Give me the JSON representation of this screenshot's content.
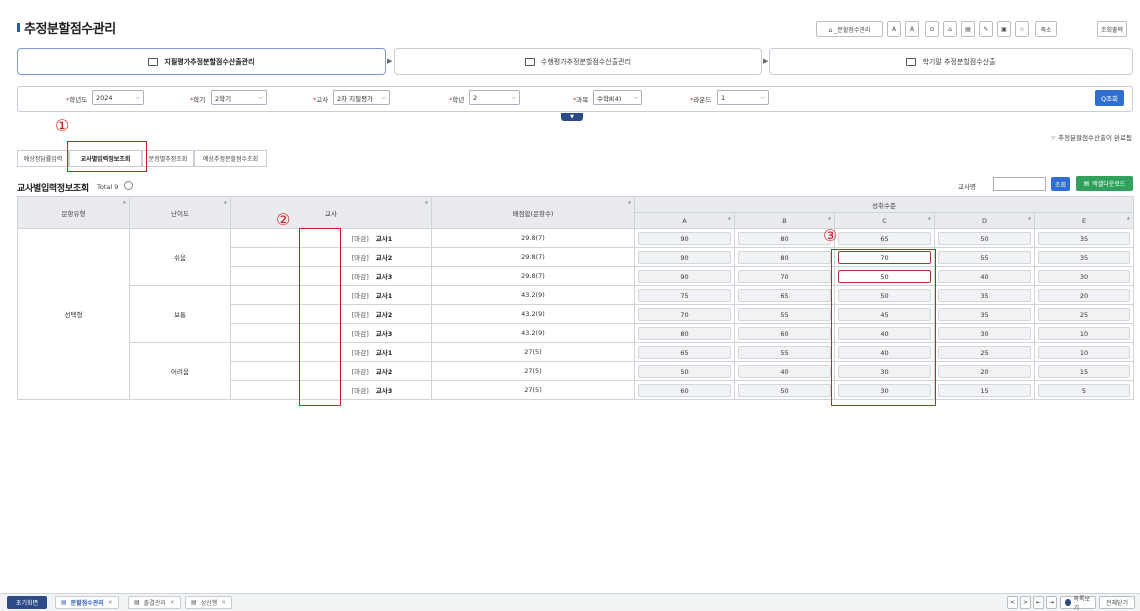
{
  "page_title": "추정분할점수관리",
  "toolbar": {
    "favorite_label": "⌂ _분할점수관리",
    "buttons": [
      "A",
      "A",
      "⊙",
      "⌂",
      "▤",
      "✎",
      "▣",
      "☆"
    ],
    "shrink_label": "축소",
    "screen_label": "조회출력"
  },
  "steps": [
    {
      "label": "지필평가추정분할점수산출관리"
    },
    {
      "label": "수행평가추정분할점수산출관리"
    },
    {
      "label": "학기말 추정분할점수산출"
    }
  ],
  "filters": {
    "year_label": "학년도",
    "year_value": "2024",
    "term_label": "학기",
    "term_value": "2학기",
    "exam_label": "고사",
    "exam_value": "2차 지필평가",
    "grade_label": "학년",
    "grade_value": "2",
    "subject_label": "과목",
    "subject_value": "수학Ⅱ(4)",
    "round_label": "라운드",
    "round_value": "1",
    "search_label": "Q조회"
  },
  "note_right": "☞ 추정분할점수산출이 완료됨",
  "annotations": {
    "one": "①",
    "two": "②",
    "three": "③"
  },
  "subtabs": [
    "예상정답률입력",
    "교사별입력정보조회",
    "문항별추정조회",
    "예상추정분할점수조회"
  ],
  "section": {
    "title": "교사별입력정보조회",
    "total": "Total 9",
    "teacher_name_label": "교사명",
    "search_label": "조회",
    "excel_label": "엑셀다운로드"
  },
  "table": {
    "headers": {
      "type": "문항유형",
      "difficulty": "난이도",
      "teacher": "교사",
      "points": "배점합(문항수)",
      "level": "성취수준",
      "levels": [
        "A",
        "B",
        "C",
        "D",
        "E"
      ]
    },
    "group_type": "선택형",
    "groups": [
      {
        "difficulty": "쉬움",
        "rows": [
          {
            "mark": "[마감]",
            "teacher": "교사1",
            "points": "29.8(7)",
            "scores": [
              "90",
              "80",
              "65",
              "50",
              "35"
            ]
          },
          {
            "mark": "[마감]",
            "teacher": "교사2",
            "points": "29.8(7)",
            "scores": [
              "90",
              "80",
              "70",
              "55",
              "35"
            ]
          },
          {
            "mark": "[마감]",
            "teacher": "교사3",
            "points": "29.8(7)",
            "scores": [
              "90",
              "70",
              "50",
              "40",
              "30"
            ]
          }
        ]
      },
      {
        "difficulty": "보통",
        "rows": [
          {
            "mark": "[마감]",
            "teacher": "교사1",
            "points": "43.2(9)",
            "scores": [
              "75",
              "65",
              "50",
              "35",
              "20"
            ]
          },
          {
            "mark": "[마감]",
            "teacher": "교사2",
            "points": "43.2(9)",
            "scores": [
              "70",
              "55",
              "45",
              "35",
              "25"
            ]
          },
          {
            "mark": "[마감]",
            "teacher": "교사3",
            "points": "43.2(9)",
            "scores": [
              "80",
              "60",
              "40",
              "30",
              "10"
            ]
          }
        ]
      },
      {
        "difficulty": "어려움",
        "rows": [
          {
            "mark": "[마감]",
            "teacher": "교사1",
            "points": "27(5)",
            "scores": [
              "65",
              "55",
              "40",
              "25",
              "10"
            ]
          },
          {
            "mark": "[마감]",
            "teacher": "교사2",
            "points": "27(5)",
            "scores": [
              "50",
              "40",
              "30",
              "20",
              "15"
            ]
          },
          {
            "mark": "[마감]",
            "teacher": "교사3",
            "points": "27(5)",
            "scores": [
              "60",
              "50",
              "30",
              "15",
              "5"
            ]
          }
        ]
      }
    ]
  },
  "footer": {
    "home_label": "초기화면",
    "tabs": [
      "분할점수관리",
      "출결관리",
      "성산행"
    ],
    "nav": [
      "<",
      ">",
      "⇤",
      "⇥"
    ],
    "list_label": "목록보기",
    "close_all_label": "전체닫기"
  }
}
